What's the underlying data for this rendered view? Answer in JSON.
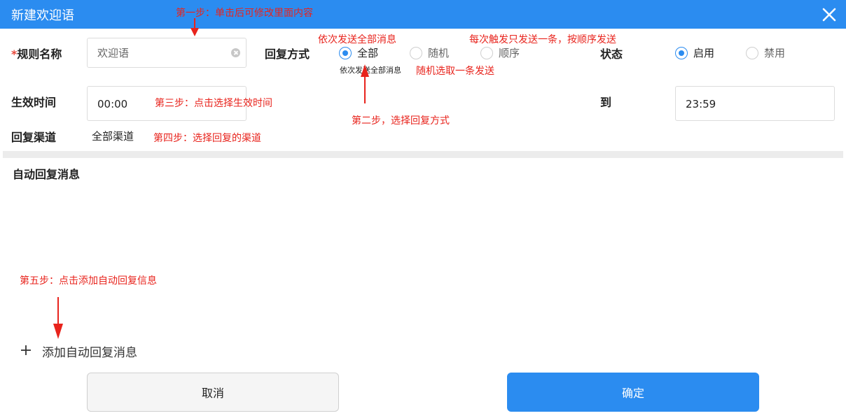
{
  "dialog": {
    "title": "新建欢迎语",
    "close_icon": "close-icon"
  },
  "form": {
    "required_mark": "*",
    "rule_name_label": "规则名称",
    "rule_name_placeholder": "欢迎语",
    "reply_mode_label": "回复方式",
    "reply_modes": [
      {
        "label": "全部",
        "selected": true
      },
      {
        "label": "随机",
        "selected": false
      },
      {
        "label": "顺序",
        "selected": false
      }
    ],
    "reply_mode_hint": "依次发送全部消息",
    "status_label": "状态",
    "statuses": [
      {
        "label": "启用",
        "selected": true
      },
      {
        "label": "禁用",
        "selected": false
      }
    ],
    "effective_time_label": "生效时间",
    "start_time": "00:00",
    "to_label": "到",
    "end_time": "23:59",
    "channel_label": "回复渠道",
    "channel_value": "全部渠道"
  },
  "auto_reply": {
    "section_title": "自动回复消息",
    "add_label": "添加自动回复消息",
    "add_icon": "plus-icon"
  },
  "footer": {
    "cancel_label": "取消",
    "confirm_label": "确定"
  },
  "annotations": {
    "step1": "第一步：单击后可修改里面内容",
    "step2": "第二步，选择回复方式",
    "step3": "第三步：点击选择生效时间",
    "step4": "第四步：选择回复的渠道",
    "step5": "第五步：点击添加自动回复信息",
    "all_mode_note": "依次发送全部消息",
    "random_mode_note": "随机选取一条发送",
    "order_mode_note": "每次触发只发送一条，按顺序发送"
  },
  "colors": {
    "primary": "#2b8cf0",
    "annotation": "#e8231c"
  }
}
